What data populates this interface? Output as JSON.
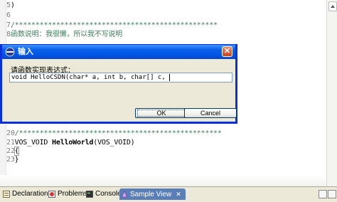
{
  "editor": {
    "lines": [
      {
        "num": "5",
        "text": ")",
        "kind": "code"
      },
      {
        "num": "6",
        "text": "",
        "kind": "code"
      },
      {
        "num": "7",
        "text": "/*************************************************",
        "kind": "comment"
      },
      {
        "num": "8",
        "text": "函数说明：我很懒，所以我不写说明",
        "kind": "comment"
      },
      {
        "num": "20",
        "text": "/*************************************************",
        "kind": "comment"
      },
      {
        "num": "21",
        "text_kw": "VOS_VOID ",
        "text_fn": "HelloWorld",
        "text_rest": "(VOS_VOID)",
        "kind": "decl"
      },
      {
        "num": "22",
        "text": "{",
        "kind": "brace"
      },
      {
        "num": "23",
        "text": "}",
        "kind": "code"
      }
    ]
  },
  "dialog": {
    "title": "输入",
    "close_label": "✕",
    "prompt": "请函数实现表达式：",
    "input_value": "void HelloCSDN(char* a, int b, char[] c, ",
    "ok_label": "OK",
    "cancel_label": "Cancel"
  },
  "views": {
    "tabs": [
      {
        "label": "Declaration",
        "icon": "declaration-icon"
      },
      {
        "label": "Problems",
        "icon": "problems-icon"
      },
      {
        "label": "Console",
        "icon": "console-icon"
      },
      {
        "label": "Sample View",
        "icon": "sample-view-icon",
        "active": true
      }
    ],
    "close_label": "✕"
  },
  "colors": {
    "comment": "#3f7f5f",
    "titlebar": "#0055e5",
    "active_tab": "#5a7fb8"
  }
}
